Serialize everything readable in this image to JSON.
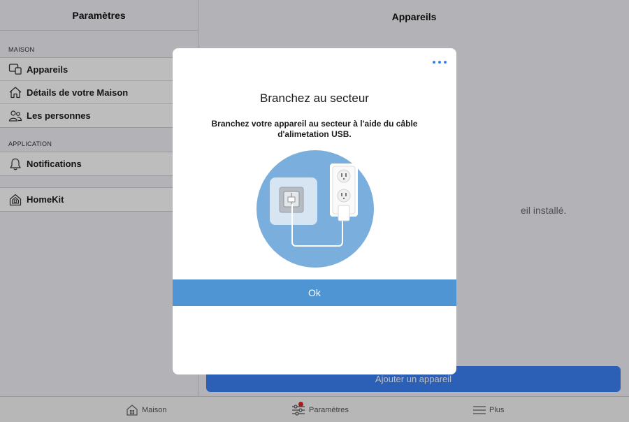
{
  "sidebar": {
    "title": "Paramètres",
    "sections": [
      {
        "label": "MAISON",
        "items": [
          {
            "label": "Appareils",
            "icon": "devices-icon"
          },
          {
            "label": "Détails de votre Maison",
            "icon": "home-outline-icon"
          },
          {
            "label": "Les personnes",
            "icon": "people-icon"
          }
        ]
      },
      {
        "label": "APPLICATION",
        "items": [
          {
            "label": "Notifications",
            "icon": "bell-icon"
          }
        ]
      }
    ],
    "standalone": {
      "label": "HomeKit",
      "icon": "homekit-icon"
    }
  },
  "detail": {
    "title": "Appareils",
    "empty_text_visible": "eil installé.",
    "add_button": "Ajouter un appareil"
  },
  "tabbar": {
    "tabs": [
      {
        "label": "Maison",
        "icon": "home-grid-icon"
      },
      {
        "label": "Paramètres",
        "icon": "sliders-icon",
        "badge": true
      },
      {
        "label": "Plus",
        "icon": "hamburger-icon"
      }
    ]
  },
  "modal": {
    "title": "Branchez au secteur",
    "description": "Branchez votre appareil au secteur à l'aide du câble d'alimetation USB.",
    "ok_button": "Ok",
    "more_icon": "ellipsis-icon",
    "illustration": "device-plugged-into-outlet-illustration"
  },
  "colors": {
    "accent": "#3b82f6",
    "ok_button": "#4f95d3",
    "illustration_circle": "#7aaedc",
    "notification_badge": "#e02424"
  }
}
